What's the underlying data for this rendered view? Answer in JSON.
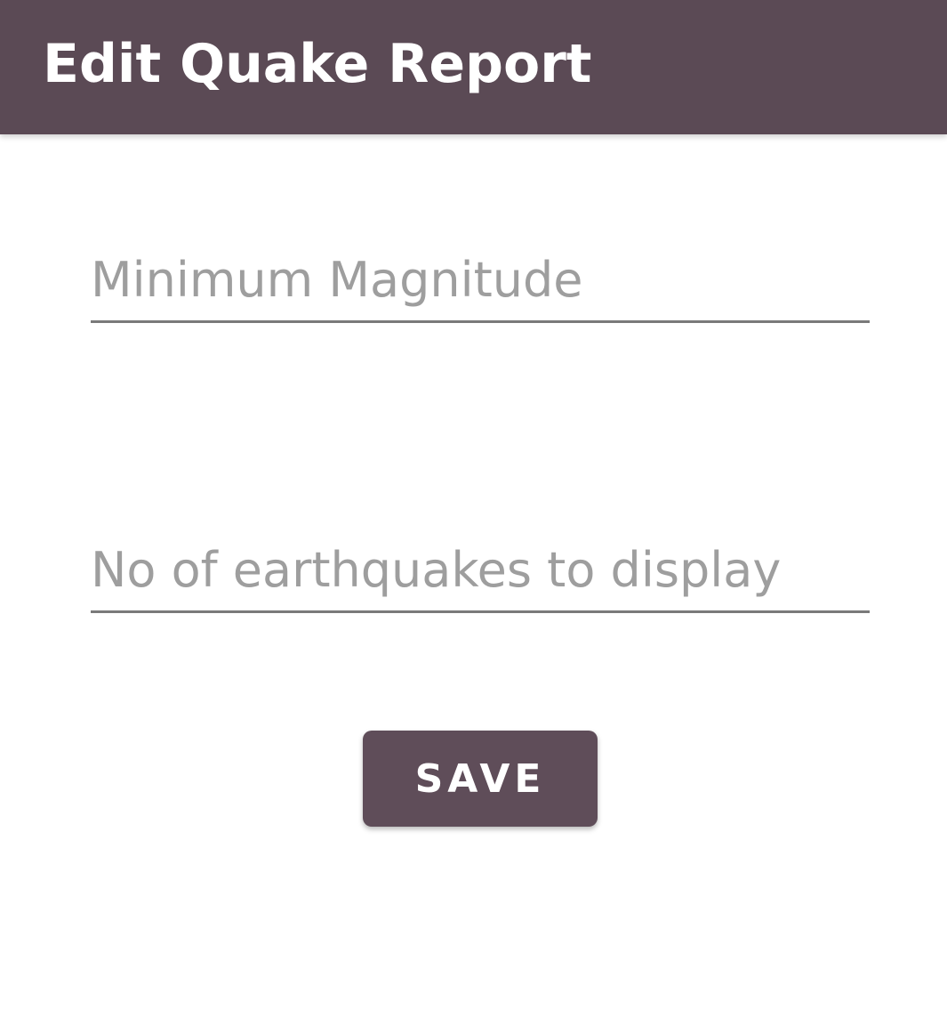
{
  "app_bar": {
    "title": "Edit Quake Report",
    "background": "#5b4a55"
  },
  "form": {
    "min_magnitude": {
      "value": "",
      "placeholder": "Minimum Magnitude"
    },
    "earthquake_count": {
      "value": "",
      "placeholder": "No of earthquakes to display"
    },
    "save_label": "SAVE"
  },
  "colors": {
    "accent": "#5f4d59",
    "placeholder": "#9e9e9e",
    "underline": "#7a7a7a"
  }
}
